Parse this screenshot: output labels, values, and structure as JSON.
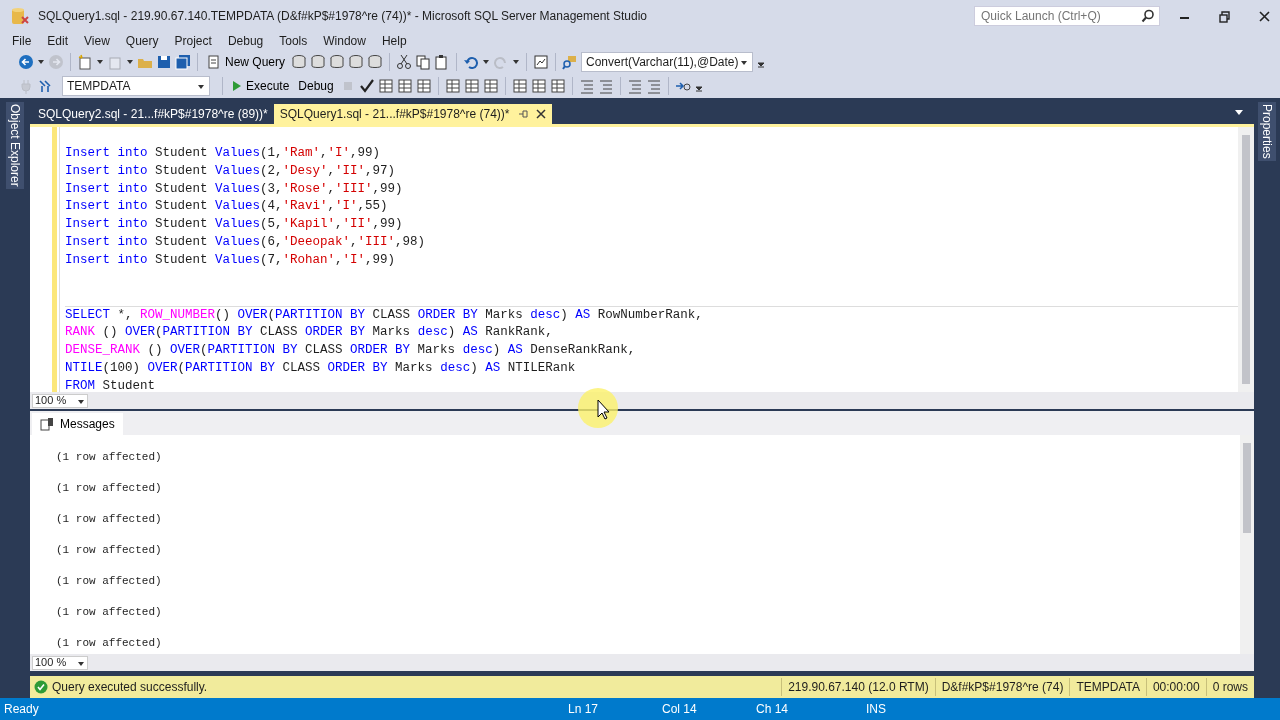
{
  "window": {
    "title": "SQLQuery1.sql - 219.90.67.140.TEMPDATA (D&f#kP$#1978^re (74))* - Microsoft SQL Server Management Studio",
    "quick_launch": {
      "placeholder": "Quick Launch (Ctrl+Q)"
    }
  },
  "menu": [
    "File",
    "Edit",
    "View",
    "Query",
    "Project",
    "Debug",
    "Tools",
    "Window",
    "Help"
  ],
  "toolbar": {
    "new_query": "New Query",
    "find_combo": "Convert(Varchar(11),@Date)",
    "database_combo": "TEMPDATA",
    "execute": "Execute",
    "debug": "Debug"
  },
  "side_panels": {
    "left": "Object Explorer",
    "right": "Properties"
  },
  "tabs": [
    {
      "label": "SQLQuery2.sql - 21...f#kP$#1978^re (89))*",
      "selected": false
    },
    {
      "label": "SQLQuery1.sql - 21...f#kP$#1978^re (74))*",
      "selected": true
    }
  ],
  "code_blocks": [
    {
      "lines": [
        [
          {
            "kind": "keyword",
            "text": "Insert into"
          },
          {
            "kind": "plain",
            "text": " Student "
          },
          {
            "kind": "keyword",
            "text": "Values"
          },
          {
            "kind": "plain",
            "text": "(1,"
          },
          {
            "kind": "string",
            "text": "'Ram'"
          },
          {
            "kind": "plain",
            "text": ","
          },
          {
            "kind": "string",
            "text": "'I'"
          },
          {
            "kind": "plain",
            "text": ",99)"
          }
        ],
        [
          {
            "kind": "keyword",
            "text": "Insert into"
          },
          {
            "kind": "plain",
            "text": " Student "
          },
          {
            "kind": "keyword",
            "text": "Values"
          },
          {
            "kind": "plain",
            "text": "(2,"
          },
          {
            "kind": "string",
            "text": "'Desy'"
          },
          {
            "kind": "plain",
            "text": ","
          },
          {
            "kind": "string",
            "text": "'II'"
          },
          {
            "kind": "plain",
            "text": ",97)"
          }
        ],
        [
          {
            "kind": "keyword",
            "text": "Insert into"
          },
          {
            "kind": "plain",
            "text": " Student "
          },
          {
            "kind": "keyword",
            "text": "Values"
          },
          {
            "kind": "plain",
            "text": "(3,"
          },
          {
            "kind": "string",
            "text": "'Rose'"
          },
          {
            "kind": "plain",
            "text": ","
          },
          {
            "kind": "string",
            "text": "'III'"
          },
          {
            "kind": "plain",
            "text": ",99)"
          }
        ],
        [
          {
            "kind": "keyword",
            "text": "Insert into"
          },
          {
            "kind": "plain",
            "text": " Student "
          },
          {
            "kind": "keyword",
            "text": "Values"
          },
          {
            "kind": "plain",
            "text": "(4,"
          },
          {
            "kind": "string",
            "text": "'Ravi'"
          },
          {
            "kind": "plain",
            "text": ","
          },
          {
            "kind": "string",
            "text": "'I'"
          },
          {
            "kind": "plain",
            "text": ",55)"
          }
        ],
        [
          {
            "kind": "keyword",
            "text": "Insert into"
          },
          {
            "kind": "plain",
            "text": " Student "
          },
          {
            "kind": "keyword",
            "text": "Values"
          },
          {
            "kind": "plain",
            "text": "(5,"
          },
          {
            "kind": "string",
            "text": "'Kapil'"
          },
          {
            "kind": "plain",
            "text": ","
          },
          {
            "kind": "string",
            "text": "'II'"
          },
          {
            "kind": "plain",
            "text": ",99)"
          }
        ],
        [
          {
            "kind": "keyword",
            "text": "Insert into"
          },
          {
            "kind": "plain",
            "text": " Student "
          },
          {
            "kind": "keyword",
            "text": "Values"
          },
          {
            "kind": "plain",
            "text": "(6,"
          },
          {
            "kind": "string",
            "text": "'Deeopak'"
          },
          {
            "kind": "plain",
            "text": ","
          },
          {
            "kind": "string",
            "text": "'III'"
          },
          {
            "kind": "plain",
            "text": ",98)"
          }
        ],
        [
          {
            "kind": "keyword",
            "text": "Insert into"
          },
          {
            "kind": "plain",
            "text": " Student "
          },
          {
            "kind": "keyword",
            "text": "Values"
          },
          {
            "kind": "plain",
            "text": "(7,"
          },
          {
            "kind": "string",
            "text": "'Rohan'"
          },
          {
            "kind": "plain",
            "text": ","
          },
          {
            "kind": "string",
            "text": "'I'"
          },
          {
            "kind": "plain",
            "text": ",99)"
          }
        ]
      ]
    },
    {
      "lines": [
        [
          {
            "kind": "keyword",
            "text": "SELECT"
          },
          {
            "kind": "plain",
            "text": " *, "
          },
          {
            "kind": "function",
            "text": "ROW_NUMBER"
          },
          {
            "kind": "plain",
            "text": "() "
          },
          {
            "kind": "keyword",
            "text": "OVER"
          },
          {
            "kind": "plain",
            "text": "("
          },
          {
            "kind": "keyword",
            "text": "PARTITION BY"
          },
          {
            "kind": "plain",
            "text": " CLASS "
          },
          {
            "kind": "keyword",
            "text": "ORDER BY"
          },
          {
            "kind": "plain",
            "text": " Marks "
          },
          {
            "kind": "keyword",
            "text": "desc"
          },
          {
            "kind": "plain",
            "text": ") "
          },
          {
            "kind": "keyword",
            "text": "AS"
          },
          {
            "kind": "plain",
            "text": " RowNumberRank,"
          }
        ],
        [
          {
            "kind": "function",
            "text": "RANK"
          },
          {
            "kind": "plain",
            "text": " () "
          },
          {
            "kind": "keyword",
            "text": "OVER"
          },
          {
            "kind": "plain",
            "text": "("
          },
          {
            "kind": "keyword",
            "text": "PARTITION BY"
          },
          {
            "kind": "plain",
            "text": " CLASS "
          },
          {
            "kind": "keyword",
            "text": "ORDER BY"
          },
          {
            "kind": "plain",
            "text": " Marks "
          },
          {
            "kind": "keyword",
            "text": "desc"
          },
          {
            "kind": "plain",
            "text": ") "
          },
          {
            "kind": "keyword",
            "text": "AS"
          },
          {
            "kind": "plain",
            "text": " RankRank,"
          }
        ],
        [
          {
            "kind": "function",
            "text": "DENSE_RANK"
          },
          {
            "kind": "plain",
            "text": " () "
          },
          {
            "kind": "keyword",
            "text": "OVER"
          },
          {
            "kind": "plain",
            "text": "("
          },
          {
            "kind": "keyword",
            "text": "PARTITION BY"
          },
          {
            "kind": "plain",
            "text": " CLASS "
          },
          {
            "kind": "keyword",
            "text": "ORDER BY"
          },
          {
            "kind": "plain",
            "text": " Marks "
          },
          {
            "kind": "keyword",
            "text": "desc"
          },
          {
            "kind": "plain",
            "text": ") "
          },
          {
            "kind": "keyword",
            "text": "AS"
          },
          {
            "kind": "plain",
            "text": " DenseRankRank,"
          }
        ],
        [
          {
            "kind": "keyword",
            "text": "NTILE"
          },
          {
            "kind": "plain",
            "text": "(100) "
          },
          {
            "kind": "keyword",
            "text": "OVER"
          },
          {
            "kind": "plain",
            "text": "("
          },
          {
            "kind": "keyword",
            "text": "PARTITION BY"
          },
          {
            "kind": "plain",
            "text": " CLASS "
          },
          {
            "kind": "keyword",
            "text": "ORDER BY"
          },
          {
            "kind": "plain",
            "text": " Marks "
          },
          {
            "kind": "keyword",
            "text": "desc"
          },
          {
            "kind": "plain",
            "text": ") "
          },
          {
            "kind": "keyword",
            "text": "AS"
          },
          {
            "kind": "plain",
            "text": " NTILERank"
          }
        ],
        [
          {
            "kind": "keyword",
            "text": "FROM"
          },
          {
            "kind": "plain",
            "text": " Student"
          }
        ]
      ]
    }
  ],
  "editor_zoom": "100 %",
  "results_tabs": [
    {
      "label": "Messages",
      "selected": true
    }
  ],
  "messages": [
    "(1 row affected)",
    "(1 row affected)",
    "(1 row affected)",
    "(1 row affected)",
    "(1 row affected)",
    "(1 row affected)",
    "(1 row affected)"
  ],
  "results_zoom": "100 %",
  "query_status": {
    "message": "Query executed successfully.",
    "server": "219.90.67.140 (12.0 RTM)",
    "user": "D&f#kP$#1978^re (74)",
    "database": "TEMPDATA",
    "elapsed": "00:00:00",
    "rows": "0 rows"
  },
  "status_bar": {
    "state": "Ready",
    "line": "Ln 17",
    "column": "Col 14",
    "char": "Ch 14",
    "mode": "INS"
  }
}
